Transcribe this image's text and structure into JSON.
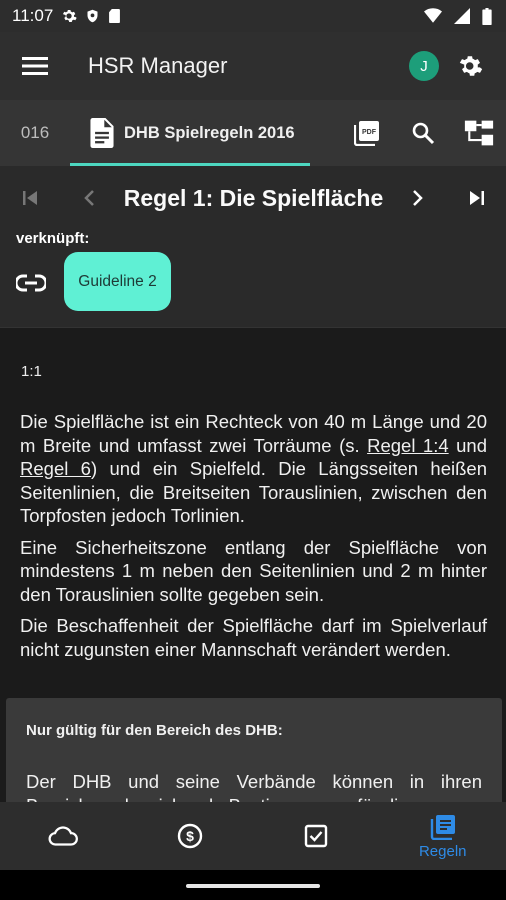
{
  "status_bar": {
    "time": "11:07"
  },
  "app_bar": {
    "title": "HSR Manager",
    "avatar_letter": "J",
    "avatar_color": "#1d9e7a"
  },
  "tabs": {
    "previous_tab": "016",
    "active_tab": "DHB Spielregeln 2016",
    "accent_color": "#4dd7c0"
  },
  "rule_nav": {
    "title": "Regel 1: Die Spielfläche"
  },
  "linked": {
    "label": "verknüpft:",
    "chip": "Guideline 2",
    "chip_color": "#5ff0d4"
  },
  "rule": {
    "number": "1:1",
    "p1_a": "Die Spielfläche ist ein Rechteck von 40 m Länge und 20 m Breite und umfasst zwei Torräume (s. ",
    "p1_link1": "Regel 1:4",
    "p1_b": " und ",
    "p1_link2": "Regel 6",
    "p1_c": ") und ein Spielfeld. Die Längsseiten heißen Seitenlinien, die Breitseiten Torauslinien, zwischen den Torpfosten jedoch Torlinien.",
    "p2": "Eine Sicherheitszone entlang der Spielfläche von mindestens 1 m neben den Seitenlinien und 2 m hinter den Torauslinien sollte gegeben sein.",
    "p3": "Die Beschaffenheit der Spielfläche darf im Spielverlauf nicht zugunsten einer Mannschaft verändert werden."
  },
  "note": {
    "title": "Nur gültig für den Bereich des DHB:",
    "body": "Der DHB und seine Verbände können in ihren Bereichen abweichende Bestimmungen für die"
  },
  "bottom_nav": {
    "items": [
      {
        "icon": "cloud-icon",
        "label": ""
      },
      {
        "icon": "dollar-icon",
        "label": ""
      },
      {
        "icon": "checkbox-icon",
        "label": ""
      },
      {
        "icon": "rules-book-icon",
        "label": "Regeln"
      }
    ],
    "active_color": "#2e8be6"
  }
}
